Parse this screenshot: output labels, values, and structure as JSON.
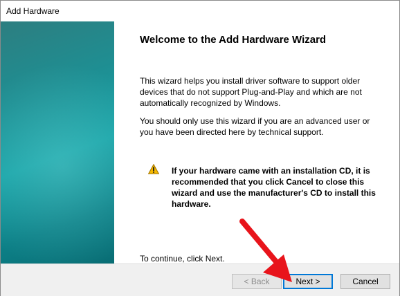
{
  "window": {
    "title": "Add Hardware"
  },
  "wizard": {
    "heading": "Welcome to the Add Hardware Wizard",
    "paragraph1": "This wizard helps you install driver software to support older devices that do not support Plug-and-Play and which are not automatically recognized by Windows.",
    "paragraph2": "You should only use this wizard if you are an advanced user or you have been directed here by technical support.",
    "warning": "If your hardware came with an installation CD, it is recommended that you click Cancel to close this wizard and use the manufacturer's CD to install this hardware.",
    "continue_text": "To continue, click Next."
  },
  "buttons": {
    "back": "< Back",
    "next": "Next >",
    "cancel": "Cancel"
  },
  "icons": {
    "warning": "warning-icon",
    "annotation": "red-arrow-icon"
  },
  "colors": {
    "banner": "#16a2a6",
    "default_button_border": "#0078d7",
    "arrow": "#e8141b",
    "warning_fill": "#f5b800"
  }
}
